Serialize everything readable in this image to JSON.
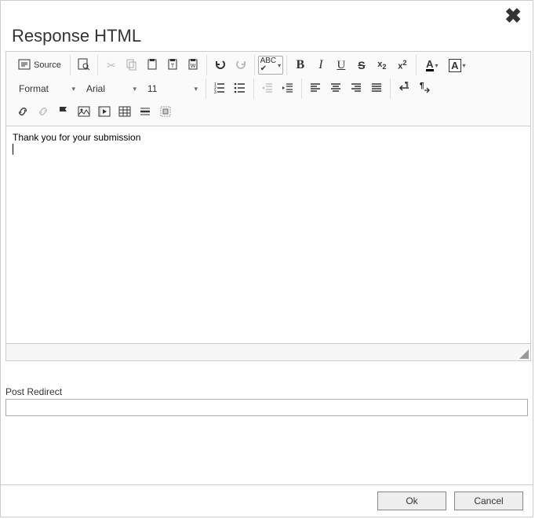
{
  "dialog": {
    "title": "Response HTML",
    "close_label": "Close"
  },
  "toolbar": {
    "source_label": "Source",
    "format_label": "Format",
    "font_label": "Arial",
    "size_label": "11"
  },
  "editor": {
    "content": "Thank you for your submission"
  },
  "post_redirect": {
    "label": "Post Redirect",
    "value": ""
  },
  "buttons": {
    "ok": "Ok",
    "cancel": "Cancel"
  }
}
